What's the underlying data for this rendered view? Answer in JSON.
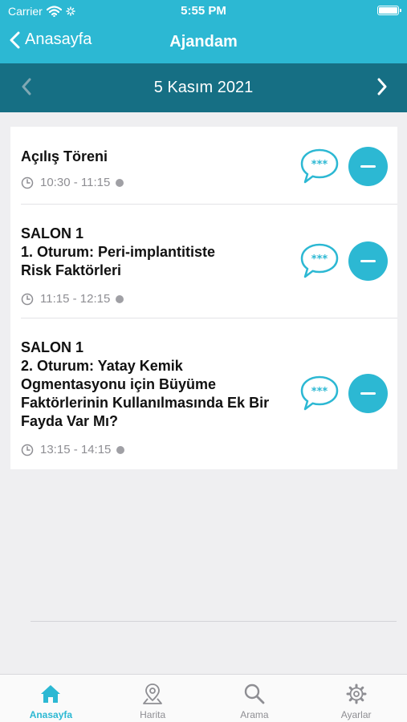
{
  "status_bar": {
    "carrier": "Carrier",
    "time": "5:55 PM"
  },
  "nav": {
    "back_label": "Anasayfa",
    "title": "Ajandam"
  },
  "date_bar": {
    "date": "5 Kasım 2021"
  },
  "sessions": [
    {
      "title_lines": [
        "Açılış Töreni"
      ],
      "time": "10:30 - 11:15"
    },
    {
      "title_lines": [
        "SALON 1",
        "1. Oturum: Peri-implantitiste",
        "Risk Faktörleri"
      ],
      "time": "11:15 - 12:15"
    },
    {
      "title_lines": [
        "SALON 1",
        "2. Oturum: Yatay Kemik",
        "Ogmentasyonu için Büyüme",
        "Faktörlerinin Kullanılmasında Ek Bir",
        "Fayda Var Mı?"
      ],
      "time": "13:15 - 14:15"
    }
  ],
  "tabs": [
    {
      "label": "Anasayfa",
      "icon": "home-icon",
      "active": true
    },
    {
      "label": "Harita",
      "icon": "map-pin-icon",
      "active": false
    },
    {
      "label": "Arama",
      "icon": "search-icon",
      "active": false
    },
    {
      "label": "Ayarlar",
      "icon": "gear-icon",
      "active": false
    }
  ],
  "colors": {
    "accent": "#2cb8d3",
    "date_bar": "#166f84",
    "background": "#efeff1",
    "inactive_tab": "#8e8e93"
  }
}
